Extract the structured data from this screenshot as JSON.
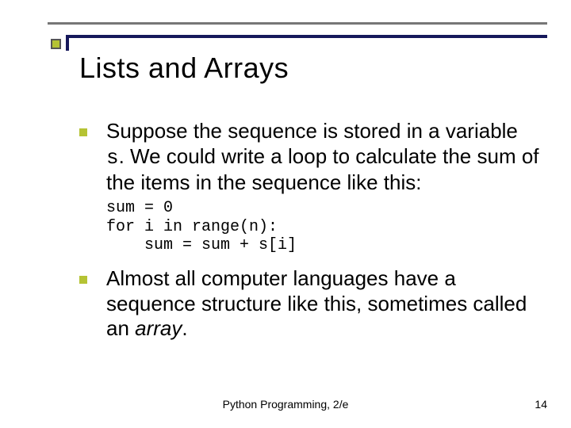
{
  "title": "Lists and Arrays",
  "bullets": [
    {
      "pre": "Suppose the sequence is stored in a variable ",
      "code": "s",
      "post": ". We could write a loop to calculate the sum of the items in the sequence like this:"
    },
    {
      "pre": "Almost all computer languages have a sequence structure like this, sometimes called an ",
      "italic": "array",
      "post": "."
    }
  ],
  "code": "sum = 0\nfor i in range(n):\n    sum = sum + s[i]",
  "footer": {
    "center": "Python Programming, 2/e",
    "page": "14"
  }
}
